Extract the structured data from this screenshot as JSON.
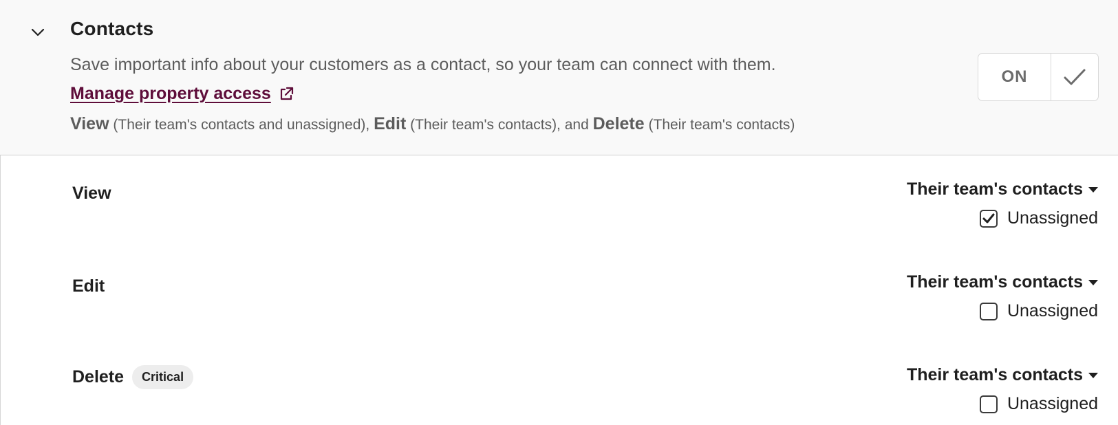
{
  "section": {
    "title": "Contacts",
    "description": "Save important info about your customers as a contact, so your team can connect with them.",
    "manage_link": "Manage property access",
    "summary": {
      "view_label": "View",
      "view_detail": "(Their team's contacts and unassigned),",
      "edit_label": "Edit",
      "edit_detail": "(Their team's contacts), and",
      "delete_label": "Delete",
      "delete_detail": "(Their team's contacts)"
    },
    "toggle": {
      "label": "ON",
      "state": true
    },
    "expanded": true
  },
  "icons": {
    "collapse": "chevron-down-icon",
    "external": "external-link-icon",
    "toggle_check": "checkmark-icon",
    "dropdown": "caret-down-icon"
  },
  "permissions": [
    {
      "label": "View",
      "badge": "",
      "scope": "Their team's contacts",
      "unassigned_label": "Unassigned",
      "unassigned_checked": true
    },
    {
      "label": "Edit",
      "badge": "",
      "scope": "Their team's contacts",
      "unassigned_label": "Unassigned",
      "unassigned_checked": false
    },
    {
      "label": "Delete",
      "badge": "Critical",
      "scope": "Their team's contacts",
      "unassigned_label": "Unassigned",
      "unassigned_checked": false
    }
  ],
  "colors": {
    "link": "#5e0d3a",
    "header_bg": "#f9f9f9",
    "badge_bg": "#ededed"
  }
}
